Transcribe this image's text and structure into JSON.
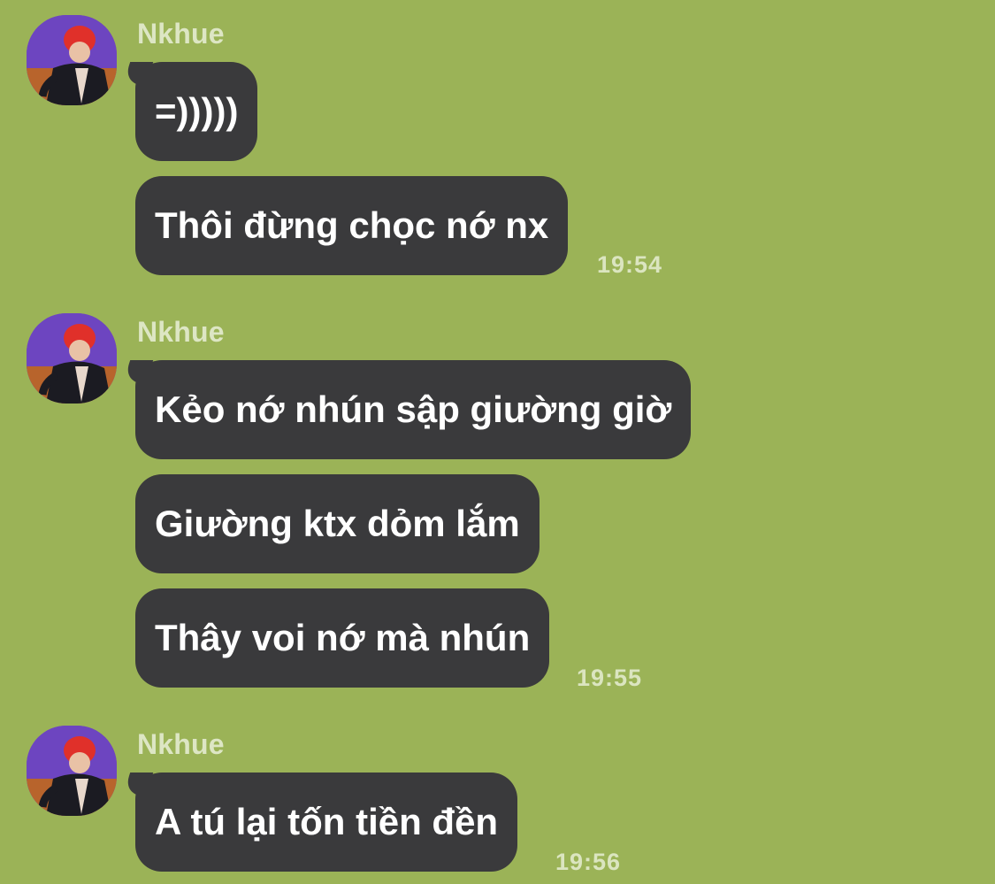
{
  "messages": [
    {
      "sender": "Nkhue",
      "avatar_icon": "profile-photo-avatar",
      "bubbles": [
        "=)))))",
        "Thôi đừng chọc nớ nx"
      ],
      "time": "19:54"
    },
    {
      "sender": "Nkhue",
      "avatar_icon": "profile-photo-avatar",
      "bubbles": [
        "Kẻo nớ nhún sập giường giờ",
        "Giường ktx dỏm lắm",
        "Thây voi nớ mà nhún"
      ],
      "time": "19:55"
    },
    {
      "sender": "Nkhue",
      "avatar_icon": "profile-photo-avatar",
      "bubbles": [
        "A tú lại tốn tiền đền"
      ],
      "time": "19:56"
    }
  ],
  "colors": {
    "background": "#9bb357",
    "bubble": "#3a3a3c",
    "bubble_text": "#ffffff",
    "sender_name": "#dde6c4",
    "timestamp": "#dbe5c0"
  }
}
